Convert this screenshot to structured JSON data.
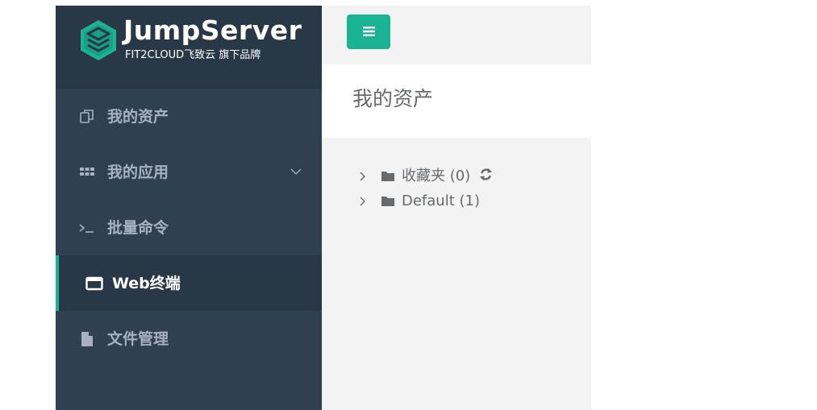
{
  "brand": {
    "name": "JumpServer",
    "tagline": "FIT2CLOUD飞致云 旗下品牌",
    "accent_color": "#1ab394",
    "icon": "jumpserver-logo-icon"
  },
  "sidebar": {
    "background_color": "#2f4050",
    "items": [
      {
        "label": "我的资产",
        "icon": "assets-icon",
        "active": false
      },
      {
        "label": "我的应用",
        "icon": "grid-icon",
        "active": false,
        "expandable": true
      },
      {
        "label": "批量命令",
        "icon": "terminal-prompt-icon",
        "active": false
      },
      {
        "label": "Web终端",
        "icon": "window-icon",
        "active": true
      },
      {
        "label": "文件管理",
        "icon": "file-icon",
        "active": false
      }
    ]
  },
  "topbar": {
    "toggle_icon": "hamburger-menu-icon"
  },
  "main": {
    "title": "我的资产",
    "tree": [
      {
        "label": "收藏夹 (0)",
        "icon": "folder-icon",
        "has_refresh": true
      },
      {
        "label": "Default (1)",
        "icon": "folder-icon",
        "has_refresh": false
      }
    ]
  }
}
